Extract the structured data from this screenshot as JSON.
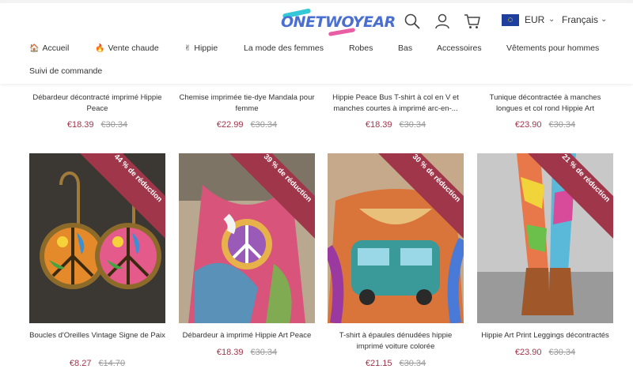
{
  "brand": {
    "logo_text": "ONETWOYEAR"
  },
  "header": {
    "currency": "EUR",
    "language": "Français",
    "icons": [
      "search-icon",
      "user-icon",
      "cart-icon"
    ]
  },
  "nav": {
    "items": [
      {
        "emoji": "🏠",
        "label": "Accueil"
      },
      {
        "emoji": "🔥",
        "label": "Vente chaude"
      },
      {
        "emoji": "✌",
        "label": "Hippie"
      },
      {
        "emoji": "",
        "label": "La mode des femmes"
      },
      {
        "emoji": "",
        "label": "Robes"
      },
      {
        "emoji": "",
        "label": "Bas"
      },
      {
        "emoji": "",
        "label": "Accessoires"
      },
      {
        "emoji": "",
        "label": "Vêtements pour hommes"
      }
    ],
    "sub_item": "Suivi de commande"
  },
  "products_top": [
    {
      "title": "Débardeur décontracté imprimé Hippie Peace",
      "price": "€18.39",
      "old_price": "€30.34"
    },
    {
      "title": "Chemise imprimée tie-dye Mandala pour femme",
      "price": "€22.99",
      "old_price": "€30.34"
    },
    {
      "title": "Hippie Peace Bus T-shirt à col en V et manches courtes à imprimé arc-en-...",
      "price": "€18.39",
      "old_price": "€30.34"
    },
    {
      "title": "Tunique décontractée à manches longues et col rond Hippie Art",
      "price": "€23.90",
      "old_price": "€30.34"
    }
  ],
  "products_bottom": [
    {
      "title": "Boucles d'Oreilles Vintage Signe de Paix",
      "price": "€8.27",
      "old_price": "€14.70",
      "badge": "44 % de réduction"
    },
    {
      "title": "Débardeur à imprimé Hippie Art Peace",
      "price": "€18.39",
      "old_price": "€30.34",
      "badge": "39 % de réduction"
    },
    {
      "title": "T-shirt à épaules dénudées hippie imprimé voiture colorée",
      "price": "€21.15",
      "old_price": "€30.34",
      "badge": "30 % de réduction"
    },
    {
      "title": "Hippie Art Print Leggings décontractés",
      "price": "€23.90",
      "old_price": "€30.34",
      "badge": "21 % de réduction"
    }
  ],
  "colors": {
    "sale": "#a0364a",
    "brand": "#4b6fd0"
  }
}
